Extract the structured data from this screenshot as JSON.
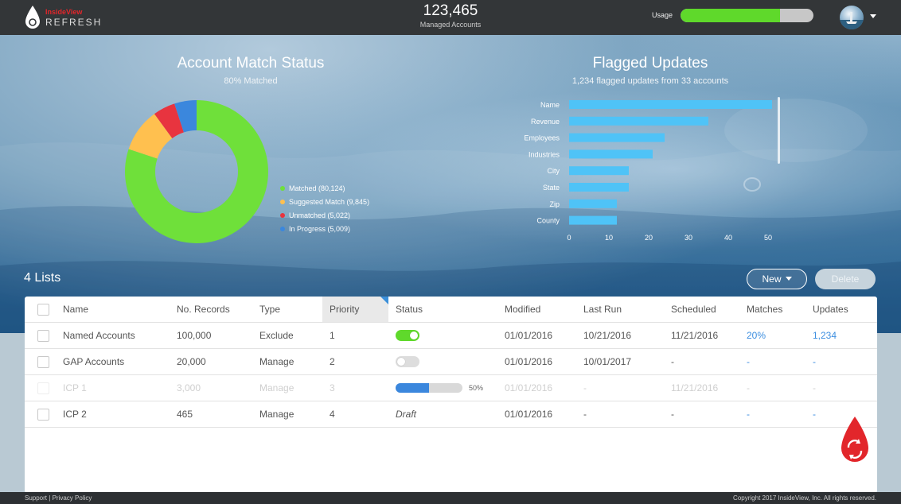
{
  "header": {
    "brand_top": "InsideView",
    "brand_bottom": "REFRESH",
    "managed_count": "123,465",
    "managed_label": "Managed Accounts",
    "usage_label": "Usage",
    "usage_fraction": 0.75
  },
  "match_status": {
    "title": "Account Match Status",
    "subtitle": "80% Matched",
    "legend": [
      {
        "label": "Matched (80,124)",
        "color": "#6fe03a"
      },
      {
        "label": "Suggested Match (9,845)",
        "color": "#ffc04f"
      },
      {
        "label": "Unmatched (5,022)",
        "color": "#e8343f"
      },
      {
        "label": "In Progress (5,009)",
        "color": "#3b87dd"
      }
    ]
  },
  "flagged": {
    "title": "Flagged Updates",
    "subtitle": "1,234 flagged updates from 33 accounts"
  },
  "chart_data": [
    {
      "type": "pie",
      "title": "Account Match Status",
      "categories": [
        "Matched",
        "Suggested Match",
        "Unmatched",
        "In Progress"
      ],
      "values": [
        80124,
        9845,
        5022,
        5009
      ],
      "colors": [
        "#6fe03a",
        "#ffc04f",
        "#e8343f",
        "#3b87dd"
      ],
      "donut": true,
      "legend": "right"
    },
    {
      "type": "bar",
      "orientation": "horizontal",
      "title": "Flagged Updates",
      "categories": [
        "Name",
        "Revenue",
        "Employees",
        "Industries",
        "City",
        "State",
        "Zip",
        "County"
      ],
      "values": [
        51,
        35,
        24,
        21,
        15,
        15,
        12,
        12
      ],
      "xlim": [
        0,
        50
      ],
      "xticks": [
        0,
        10,
        20,
        30,
        40,
        50
      ],
      "color": "#4fc3f7"
    }
  ],
  "lists": {
    "title": "4 Lists",
    "new_label": "New",
    "delete_label": "Delete",
    "columns": [
      "Name",
      "No. Records",
      "Type",
      "Priority",
      "Status",
      "Modified",
      "Last Run",
      "Scheduled",
      "Matches",
      "Updates"
    ],
    "rows": [
      {
        "name": "Named Accounts",
        "records": "100,000",
        "type": "Exclude",
        "priority": "1",
        "status": "on",
        "modified": "01/01/2016",
        "last_run": "10/21/2016",
        "scheduled": "11/21/2016",
        "matches": "20%",
        "updates": "1,234"
      },
      {
        "name": "GAP Accounts",
        "records": "20,000",
        "type": "Manage",
        "priority": "2",
        "status": "off",
        "modified": "01/01/2016",
        "last_run": "10/01/2017",
        "scheduled": "-",
        "matches": "-",
        "updates": "-"
      },
      {
        "name": "ICP 1",
        "records": "3,000",
        "type": "Manage",
        "priority": "3",
        "status": "progress",
        "progress_label": "50%",
        "progress_fraction": 0.5,
        "modified": "01/01/2016",
        "last_run": "-",
        "scheduled": "11/21/2016",
        "matches": "-",
        "updates": "-"
      },
      {
        "name": "ICP 2",
        "records": "465",
        "type": "Manage",
        "priority": "4",
        "status": "draft",
        "status_text": "Draft",
        "modified": "01/01/2016",
        "last_run": "-",
        "scheduled": "-",
        "matches": "-",
        "updates": "-"
      }
    ]
  },
  "footer": {
    "support": "Support",
    "separator": "|",
    "privacy": "Privacy Policy",
    "copyright": "Copyright 2017 InsideView, Inc. All rights reserved."
  }
}
